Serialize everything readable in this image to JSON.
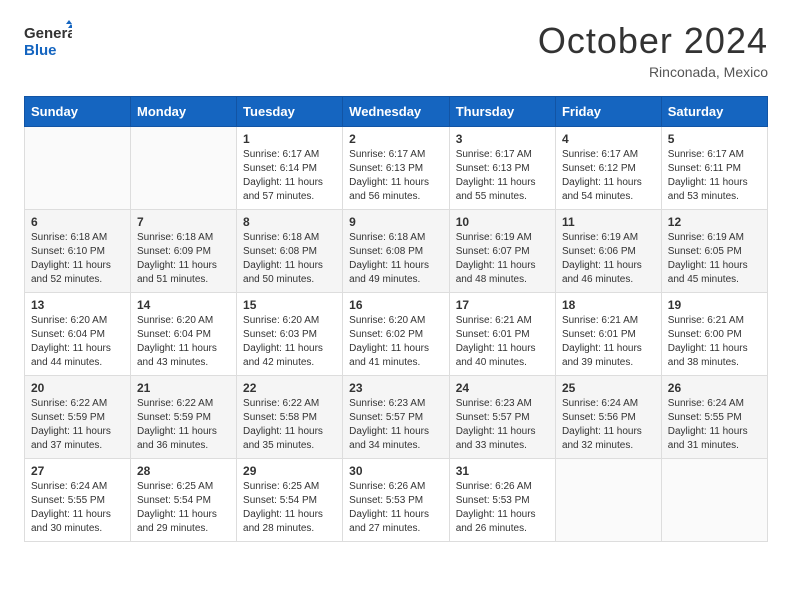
{
  "header": {
    "logo_line1": "General",
    "logo_line2": "Blue",
    "month": "October 2024",
    "location": "Rinconada, Mexico"
  },
  "weekdays": [
    "Sunday",
    "Monday",
    "Tuesday",
    "Wednesday",
    "Thursday",
    "Friday",
    "Saturday"
  ],
  "weeks": [
    [
      {
        "day": "",
        "sunrise": "",
        "sunset": "",
        "daylight": ""
      },
      {
        "day": "",
        "sunrise": "",
        "sunset": "",
        "daylight": ""
      },
      {
        "day": "1",
        "sunrise": "Sunrise: 6:17 AM",
        "sunset": "Sunset: 6:14 PM",
        "daylight": "Daylight: 11 hours and 57 minutes."
      },
      {
        "day": "2",
        "sunrise": "Sunrise: 6:17 AM",
        "sunset": "Sunset: 6:13 PM",
        "daylight": "Daylight: 11 hours and 56 minutes."
      },
      {
        "day": "3",
        "sunrise": "Sunrise: 6:17 AM",
        "sunset": "Sunset: 6:13 PM",
        "daylight": "Daylight: 11 hours and 55 minutes."
      },
      {
        "day": "4",
        "sunrise": "Sunrise: 6:17 AM",
        "sunset": "Sunset: 6:12 PM",
        "daylight": "Daylight: 11 hours and 54 minutes."
      },
      {
        "day": "5",
        "sunrise": "Sunrise: 6:17 AM",
        "sunset": "Sunset: 6:11 PM",
        "daylight": "Daylight: 11 hours and 53 minutes."
      }
    ],
    [
      {
        "day": "6",
        "sunrise": "Sunrise: 6:18 AM",
        "sunset": "Sunset: 6:10 PM",
        "daylight": "Daylight: 11 hours and 52 minutes."
      },
      {
        "day": "7",
        "sunrise": "Sunrise: 6:18 AM",
        "sunset": "Sunset: 6:09 PM",
        "daylight": "Daylight: 11 hours and 51 minutes."
      },
      {
        "day": "8",
        "sunrise": "Sunrise: 6:18 AM",
        "sunset": "Sunset: 6:08 PM",
        "daylight": "Daylight: 11 hours and 50 minutes."
      },
      {
        "day": "9",
        "sunrise": "Sunrise: 6:18 AM",
        "sunset": "Sunset: 6:08 PM",
        "daylight": "Daylight: 11 hours and 49 minutes."
      },
      {
        "day": "10",
        "sunrise": "Sunrise: 6:19 AM",
        "sunset": "Sunset: 6:07 PM",
        "daylight": "Daylight: 11 hours and 48 minutes."
      },
      {
        "day": "11",
        "sunrise": "Sunrise: 6:19 AM",
        "sunset": "Sunset: 6:06 PM",
        "daylight": "Daylight: 11 hours and 46 minutes."
      },
      {
        "day": "12",
        "sunrise": "Sunrise: 6:19 AM",
        "sunset": "Sunset: 6:05 PM",
        "daylight": "Daylight: 11 hours and 45 minutes."
      }
    ],
    [
      {
        "day": "13",
        "sunrise": "Sunrise: 6:20 AM",
        "sunset": "Sunset: 6:04 PM",
        "daylight": "Daylight: 11 hours and 44 minutes."
      },
      {
        "day": "14",
        "sunrise": "Sunrise: 6:20 AM",
        "sunset": "Sunset: 6:04 PM",
        "daylight": "Daylight: 11 hours and 43 minutes."
      },
      {
        "day": "15",
        "sunrise": "Sunrise: 6:20 AM",
        "sunset": "Sunset: 6:03 PM",
        "daylight": "Daylight: 11 hours and 42 minutes."
      },
      {
        "day": "16",
        "sunrise": "Sunrise: 6:20 AM",
        "sunset": "Sunset: 6:02 PM",
        "daylight": "Daylight: 11 hours and 41 minutes."
      },
      {
        "day": "17",
        "sunrise": "Sunrise: 6:21 AM",
        "sunset": "Sunset: 6:01 PM",
        "daylight": "Daylight: 11 hours and 40 minutes."
      },
      {
        "day": "18",
        "sunrise": "Sunrise: 6:21 AM",
        "sunset": "Sunset: 6:01 PM",
        "daylight": "Daylight: 11 hours and 39 minutes."
      },
      {
        "day": "19",
        "sunrise": "Sunrise: 6:21 AM",
        "sunset": "Sunset: 6:00 PM",
        "daylight": "Daylight: 11 hours and 38 minutes."
      }
    ],
    [
      {
        "day": "20",
        "sunrise": "Sunrise: 6:22 AM",
        "sunset": "Sunset: 5:59 PM",
        "daylight": "Daylight: 11 hours and 37 minutes."
      },
      {
        "day": "21",
        "sunrise": "Sunrise: 6:22 AM",
        "sunset": "Sunset: 5:59 PM",
        "daylight": "Daylight: 11 hours and 36 minutes."
      },
      {
        "day": "22",
        "sunrise": "Sunrise: 6:22 AM",
        "sunset": "Sunset: 5:58 PM",
        "daylight": "Daylight: 11 hours and 35 minutes."
      },
      {
        "day": "23",
        "sunrise": "Sunrise: 6:23 AM",
        "sunset": "Sunset: 5:57 PM",
        "daylight": "Daylight: 11 hours and 34 minutes."
      },
      {
        "day": "24",
        "sunrise": "Sunrise: 6:23 AM",
        "sunset": "Sunset: 5:57 PM",
        "daylight": "Daylight: 11 hours and 33 minutes."
      },
      {
        "day": "25",
        "sunrise": "Sunrise: 6:24 AM",
        "sunset": "Sunset: 5:56 PM",
        "daylight": "Daylight: 11 hours and 32 minutes."
      },
      {
        "day": "26",
        "sunrise": "Sunrise: 6:24 AM",
        "sunset": "Sunset: 5:55 PM",
        "daylight": "Daylight: 11 hours and 31 minutes."
      }
    ],
    [
      {
        "day": "27",
        "sunrise": "Sunrise: 6:24 AM",
        "sunset": "Sunset: 5:55 PM",
        "daylight": "Daylight: 11 hours and 30 minutes."
      },
      {
        "day": "28",
        "sunrise": "Sunrise: 6:25 AM",
        "sunset": "Sunset: 5:54 PM",
        "daylight": "Daylight: 11 hours and 29 minutes."
      },
      {
        "day": "29",
        "sunrise": "Sunrise: 6:25 AM",
        "sunset": "Sunset: 5:54 PM",
        "daylight": "Daylight: 11 hours and 28 minutes."
      },
      {
        "day": "30",
        "sunrise": "Sunrise: 6:26 AM",
        "sunset": "Sunset: 5:53 PM",
        "daylight": "Daylight: 11 hours and 27 minutes."
      },
      {
        "day": "31",
        "sunrise": "Sunrise: 6:26 AM",
        "sunset": "Sunset: 5:53 PM",
        "daylight": "Daylight: 11 hours and 26 minutes."
      },
      {
        "day": "",
        "sunrise": "",
        "sunset": "",
        "daylight": ""
      },
      {
        "day": "",
        "sunrise": "",
        "sunset": "",
        "daylight": ""
      }
    ]
  ]
}
